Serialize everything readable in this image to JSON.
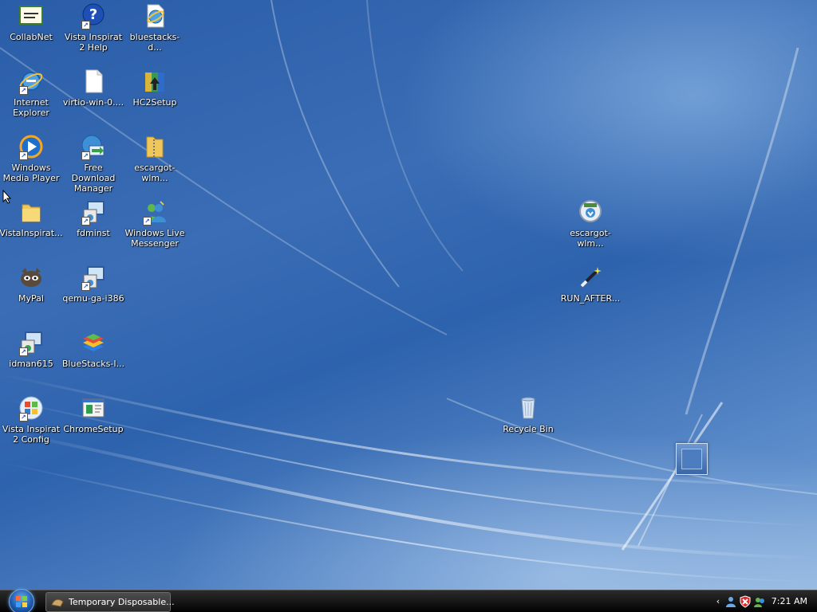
{
  "desktop": {
    "icons": [
      {
        "id": "collabnet",
        "label": "CollabNet",
        "icon": "certificate-icon"
      },
      {
        "id": "vista-help",
        "label": "Vista Inspirat 2 Help",
        "icon": "help-icon"
      },
      {
        "id": "bluestacks-d",
        "label": "bluestacks-d...",
        "icon": "ie-document-icon"
      },
      {
        "id": "internet-explorer",
        "label": "Internet Explorer",
        "icon": "internet-explorer-icon"
      },
      {
        "id": "virtio-win",
        "label": "virtio-win-0....",
        "icon": "file-icon"
      },
      {
        "id": "hc2setup",
        "label": "HC2Setup",
        "icon": "winrar-archive-icon"
      },
      {
        "id": "windows-media-player",
        "label": "Windows Media Player",
        "icon": "media-player-icon"
      },
      {
        "id": "free-download-manager",
        "label": "Free Download Manager",
        "icon": "download-manager-icon"
      },
      {
        "id": "escargot-wlm-zip",
        "label": "escargot-wlm...",
        "icon": "zip-folder-icon"
      },
      {
        "id": "vistainspirat",
        "label": "VistaInspirat...",
        "icon": "folder-icon"
      },
      {
        "id": "fdminst",
        "label": "fdminst",
        "icon": "installer-icon"
      },
      {
        "id": "windows-live-messenger",
        "label": "Windows Live Messenger",
        "icon": "messenger-icon"
      },
      {
        "id": "mypal",
        "label": "MyPal",
        "icon": "mypal-raccoon-icon"
      },
      {
        "id": "qemu-ga",
        "label": "qemu-ga-i386",
        "icon": "installer-icon"
      },
      {
        "id": "idman615",
        "label": "idman615",
        "icon": "installer-icon"
      },
      {
        "id": "bluestacks-i",
        "label": "BlueStacks-I...",
        "icon": "bluestacks-icon"
      },
      {
        "id": "vista-config",
        "label": "Vista Inspirat 2 Config",
        "icon": "windows-logo-icon"
      },
      {
        "id": "chromesetup",
        "label": "ChromeSetup",
        "icon": "setup-icon"
      },
      {
        "id": "escargot-wlm-installer",
        "label": "escargot-wlm...",
        "icon": "msn-installer-icon"
      },
      {
        "id": "run-after",
        "label": "RUN_AFTER...",
        "icon": "magic-wand-icon"
      },
      {
        "id": "recycle-bin",
        "label": "Recycle Bin",
        "icon": "recycle-bin-icon"
      }
    ]
  },
  "taskbar": {
    "start_button": "start-orb-icon",
    "task_button_label": "Temporary Disposable...",
    "tray_icons": [
      "chevron-left-icon",
      "network-user-icon",
      "security-shield-icon",
      "messenger-status-icon"
    ],
    "clock": "7:21 AM"
  },
  "colors": {
    "desktop_bg": "#2a5da8",
    "taskbar_bg": "#1b1b1b",
    "label_text": "#ffffff"
  }
}
